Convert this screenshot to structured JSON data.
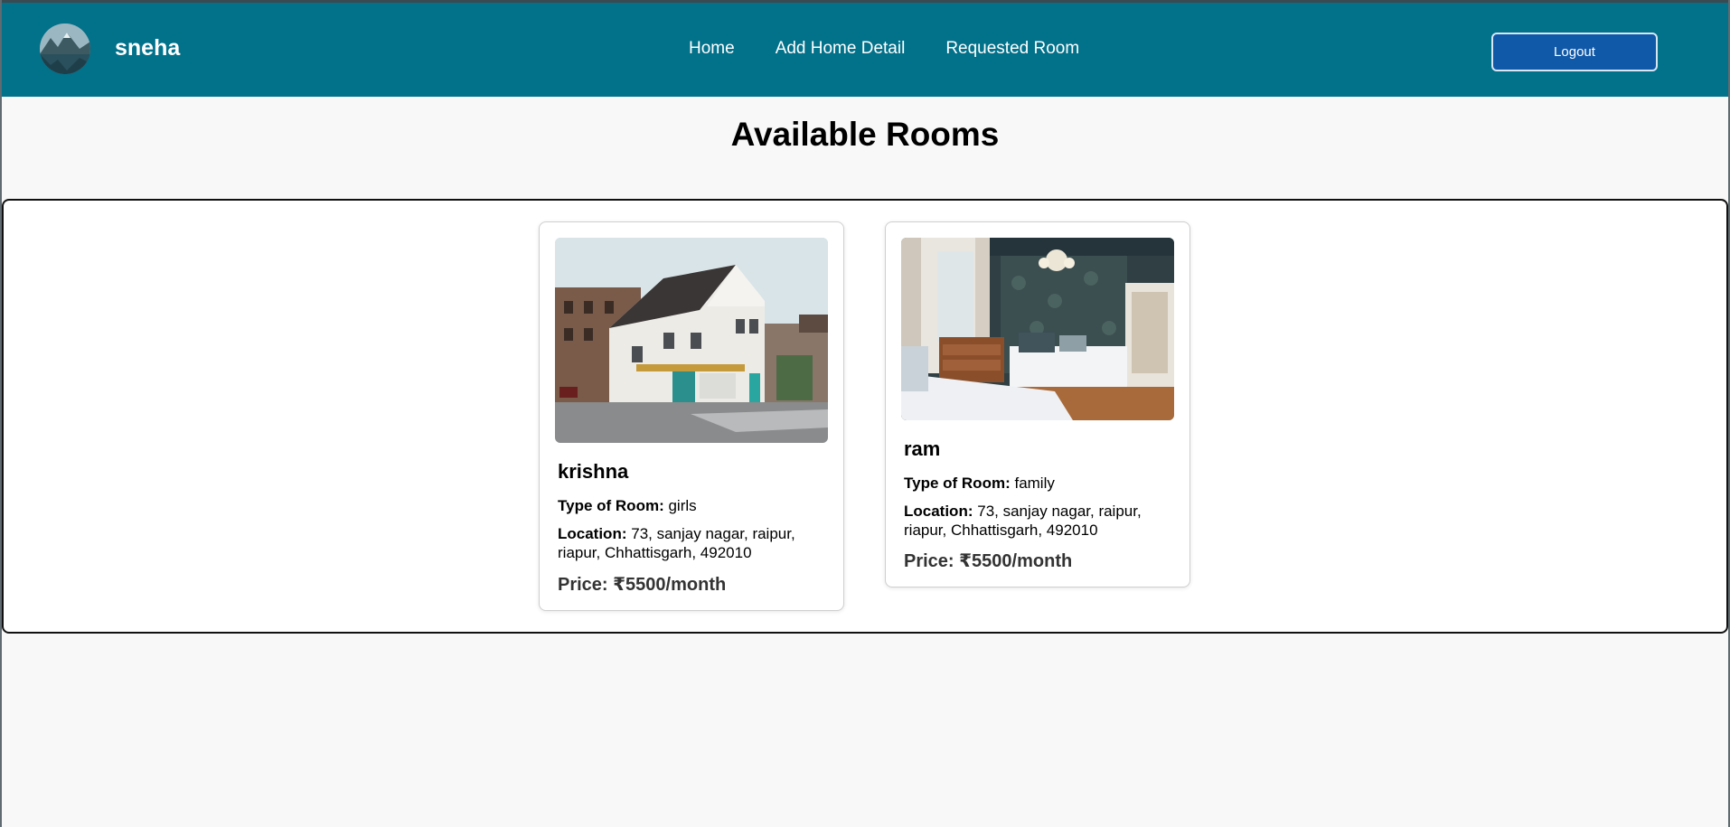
{
  "header": {
    "username": "sneha",
    "nav": [
      "Home",
      "Add Home Detail",
      "Requested Room"
    ],
    "logout_label": "Logout"
  },
  "page": {
    "title": "Available Rooms"
  },
  "rooms": [
    {
      "name": "krishna",
      "type_label": "Type of Room:",
      "type": "girls",
      "location_label": "Location:",
      "location": "73, sanjay nagar, raipur, riapur, Chhattisgarh, 492010",
      "price": "Price: ₹5500/month"
    },
    {
      "name": "ram",
      "type_label": "Type of Room:",
      "type": "family",
      "location_label": "Location:",
      "location": "73, sanjay nagar, raipur, riapur, Chhattisgarh, 492010",
      "price": "Price: ₹5500/month"
    }
  ],
  "colors": {
    "header_bg": "#02718a",
    "logout_bg": "#1058a8",
    "page_bg": "#f8f8f8"
  }
}
